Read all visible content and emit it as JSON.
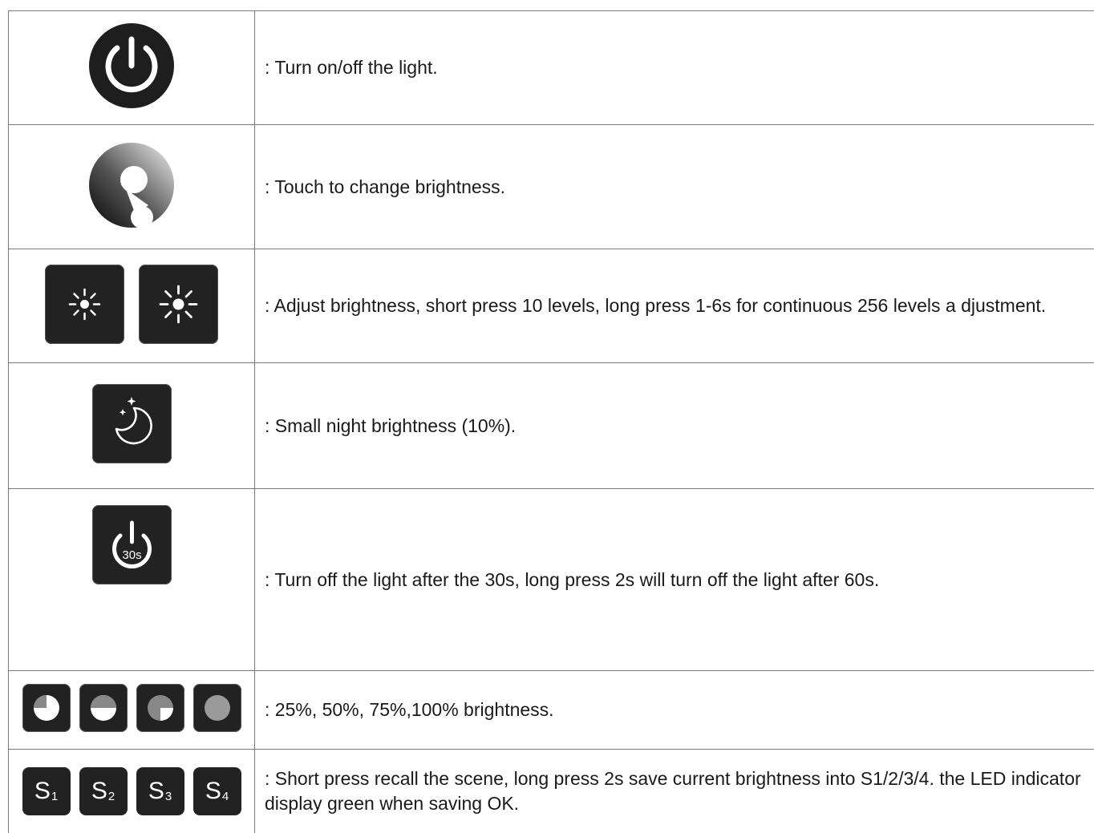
{
  "rows": [
    {
      "icon": "power-icon",
      "text": ": Turn on/off the light."
    },
    {
      "icon": "brightness-ring-icon",
      "text": ": Touch to change brightness."
    },
    {
      "icons": [
        "brightness-down-icon",
        "brightness-up-icon"
      ],
      "text": ": Adjust brightness, short press 10 levels, long press 1-6s for continuous 256 levels a djustment."
    },
    {
      "icon": "night-moon-icon",
      "text": ": Small night brightness (10%)."
    },
    {
      "icon": "timer-30s-icon",
      "icon_label": "30s",
      "text": ": Turn off the light after the 30s, long press 2s will turn off the light after 60s."
    },
    {
      "icons": [
        "brightness-25-icon",
        "brightness-50-icon",
        "brightness-75-icon",
        "brightness-100-icon"
      ],
      "text": ": 25%, 50%, 75%,100% brightness."
    },
    {
      "scenes": [
        {
          "letter": "S",
          "num": "1"
        },
        {
          "letter": "S",
          "num": "2"
        },
        {
          "letter": "S",
          "num": "3"
        },
        {
          "letter": "S",
          "num": "4"
        }
      ],
      "text": ": Short press recall the scene, long press 2s save current brightness into S1/2/3/4. the LED indicator display green when saving OK."
    }
  ],
  "colors": {
    "button": "#222222",
    "border": "#7a7a7a",
    "text": "#1a1a1a"
  }
}
